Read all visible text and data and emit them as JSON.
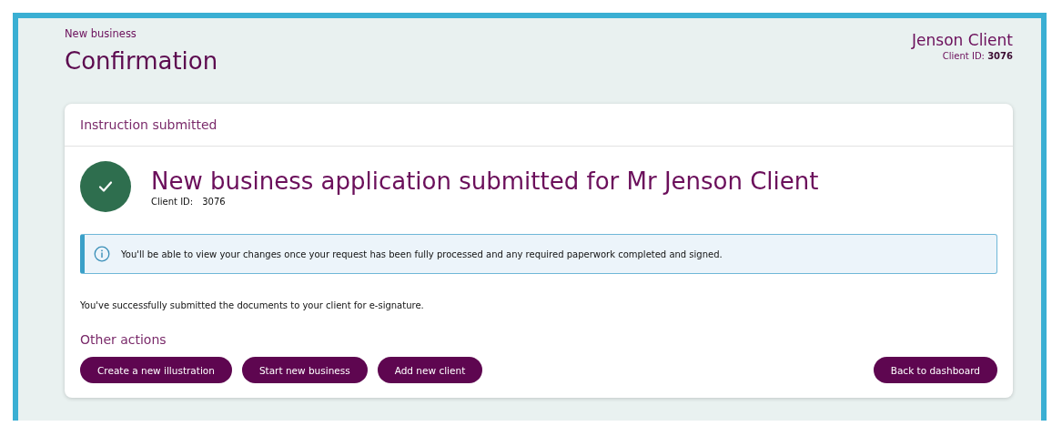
{
  "header": {
    "breadcrumb": "New business",
    "title": "Confirmation",
    "client_name": "Jenson Client",
    "client_id": "Client ID: **3076**"
  },
  "card": {
    "header": "Instruction submitted",
    "heading": "New business application submitted for Mr Jenson Client",
    "client_id_label": "Client ID:",
    "client_id_value": "3076",
    "info": "You'll be able to view your changes once your request has been fully processed and any required paperwork completed and signed.",
    "message": "You've successfully submitted the documents to your client for e-signature.",
    "actions_title": "Other actions",
    "actions": [
      {
        "label": "Create a new illustration"
      },
      {
        "label": "Start new business"
      },
      {
        "label": "Add new client"
      }
    ],
    "back_button": "Back to dashboard"
  }
}
